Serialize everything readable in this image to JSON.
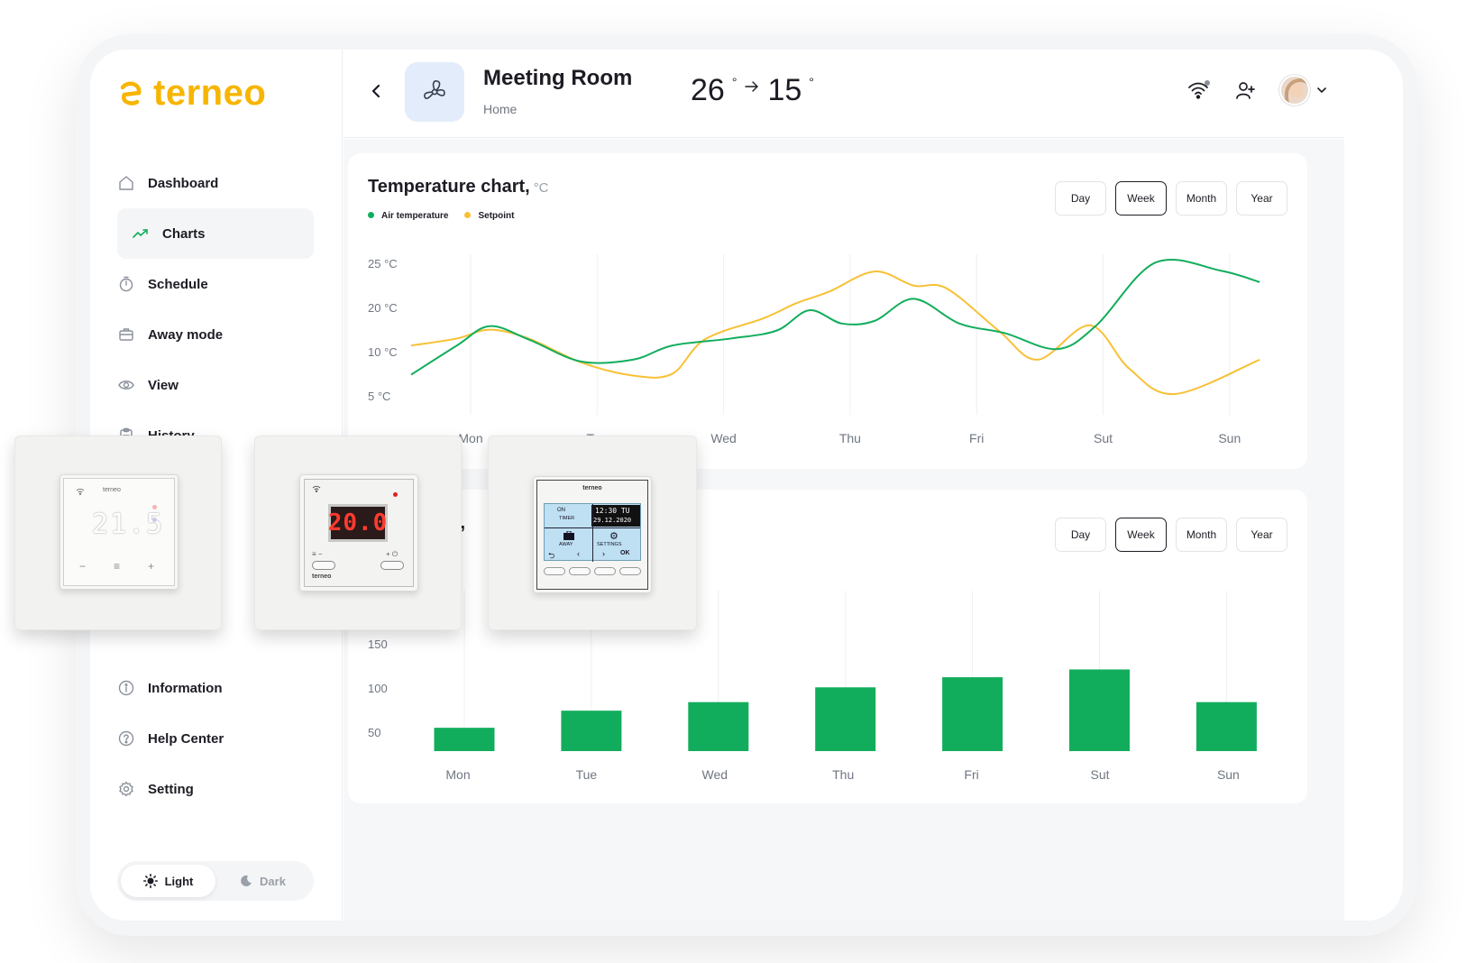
{
  "brand": {
    "name": "terneo",
    "color": "#f7b500"
  },
  "sidebar": {
    "items": [
      {
        "label": "Dashboard",
        "icon": "home-icon"
      },
      {
        "label": "Charts",
        "icon": "trend-icon",
        "active": true
      },
      {
        "label": "Schedule",
        "icon": "timer-icon"
      },
      {
        "label": "Away mode",
        "icon": "briefcase-icon"
      },
      {
        "label": "View",
        "icon": "eye-icon"
      },
      {
        "label": "History",
        "icon": "clipboard-icon"
      }
    ],
    "bottom_items": [
      {
        "label": "Information",
        "icon": "info-icon"
      },
      {
        "label": "Help Center",
        "icon": "help-icon"
      },
      {
        "label": "Setting",
        "icon": "gear-icon"
      }
    ],
    "theme": {
      "light": "Light",
      "dark": "Dark",
      "selected": "Light"
    }
  },
  "header": {
    "title": "Meeting Room",
    "subtitle": "Home",
    "temp_current": "26",
    "temp_target": "15",
    "degree": "°"
  },
  "chart1": {
    "title": "Temperature chart,",
    "unit": "°C",
    "legend": [
      {
        "name": "Air temperature",
        "color": "#12ad5c"
      },
      {
        "name": "Setpoint",
        "color": "#f8c035"
      }
    ],
    "ranges": [
      "Day",
      "Week",
      "Month",
      "Year"
    ],
    "selected_range": "Week"
  },
  "chart2": {
    "title_partial": "rt,",
    "ranges": [
      "Day",
      "Week",
      "Month",
      "Year"
    ],
    "selected_range": "Week"
  },
  "devices": {
    "dev1": {
      "brand": "terneo",
      "reading": "21.5"
    },
    "dev2": {
      "brand": "terneo",
      "reading": "20.0"
    },
    "dev3": {
      "brand": "terneo",
      "line1": "ON",
      "line2": "TIMER",
      "clock": "12:30 TU",
      "date": "29.12.2020",
      "away": "AWAY",
      "settings": "SETTINGS",
      "ok": "OK"
    }
  },
  "chart_data": [
    {
      "type": "line",
      "title": "Temperature chart,",
      "y_unit": "°C",
      "categories": [
        "Mon",
        "Tue",
        "Wed",
        "Thu",
        "Fri",
        "Sut",
        "Sun"
      ],
      "y_ticks": [
        "25 °C",
        "20 °C",
        "10 °C",
        "5 °C"
      ],
      "grid": true,
      "legend_position": "top-left",
      "series": [
        {
          "name": "Air temperature",
          "color": "#12ad5c",
          "x": [
            0,
            0.35,
            0.6,
            0.9,
            1.3,
            1.7,
            2.0,
            2.45,
            2.8,
            3.05,
            3.3,
            3.55,
            3.85,
            4.2,
            4.55,
            4.95,
            5.25,
            5.7,
            6.2,
            6.5
          ],
          "values": [
            7.4,
            10.7,
            12.9,
            11.4,
            8.9,
            9.1,
            10.7,
            11.5,
            12.4,
            14.7,
            13.2,
            13.5,
            16.0,
            13.2,
            12.1,
            10.3,
            13.0,
            20.1,
            19.2,
            17.9
          ]
        },
        {
          "name": "Setpoint",
          "color": "#f8c035",
          "x": [
            0,
            0.35,
            0.6,
            0.9,
            1.3,
            1.7,
            2.0,
            2.25,
            2.7,
            2.95,
            3.2,
            3.55,
            3.85,
            4.1,
            4.5,
            4.8,
            5.2,
            5.5,
            5.85,
            6.5
          ],
          "values": [
            10.7,
            11.5,
            12.5,
            11.5,
            8.8,
            7.3,
            7.5,
            11.4,
            13.8,
            15.5,
            16.8,
            19.1,
            17.5,
            17.2,
            12.4,
            9.1,
            13.0,
            8.1,
            5.2,
            9.1
          ]
        }
      ]
    },
    {
      "type": "bar",
      "categories": [
        "Mon",
        "Tue",
        "Wed",
        "Thu",
        "Fri",
        "Sut",
        "Sun"
      ],
      "values": [
        30,
        52,
        63,
        82,
        95,
        105,
        63
      ],
      "y_ticks": [
        "150",
        "100",
        "50"
      ],
      "color": "#12ad5c"
    }
  ]
}
